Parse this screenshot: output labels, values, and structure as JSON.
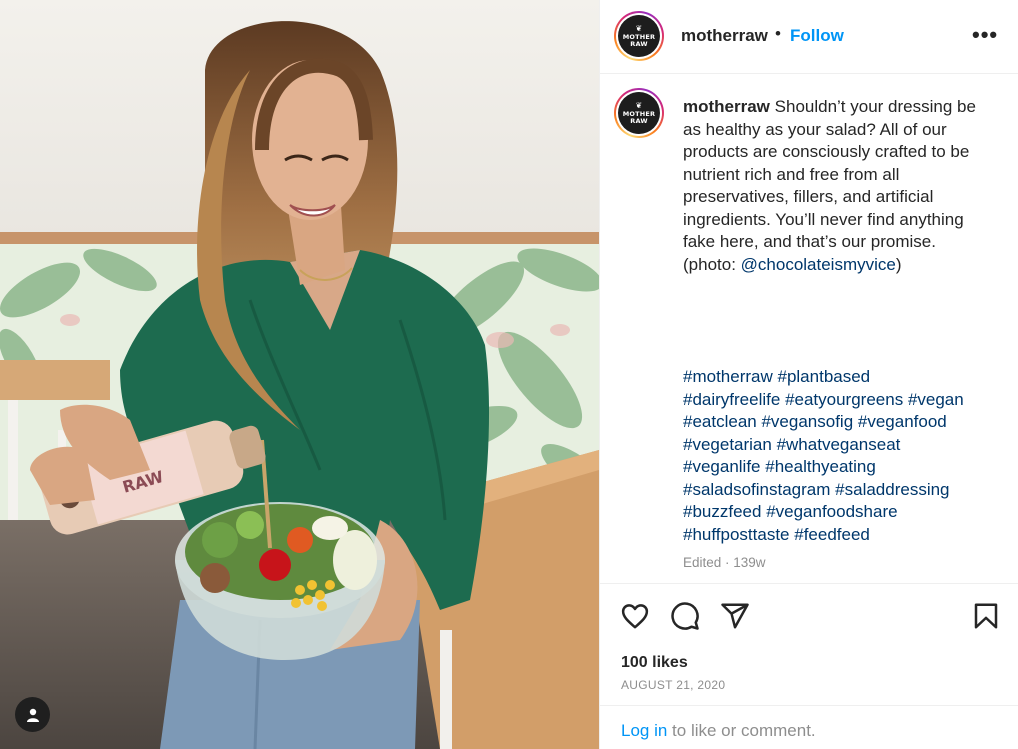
{
  "post": {
    "username": "motherraw",
    "header_separator": "•",
    "follow_label": "Follow",
    "more_label": "•••",
    "avatar_text": [
      "MOTHER",
      "RAW"
    ],
    "caption_user": "motherraw",
    "caption_text": " Shouldn’t your dressing be as healthy as your salad? All of our products are consciously crafted to be nutrient rich and free from all preservatives, fillers, and artificial ingredients. You’ll never find anything fake here, and that’s our promise. (photo: ",
    "caption_mention": "@chocolateismyvice",
    "caption_end": ")",
    "hashtags": [
      "#motherraw",
      "#plantbased",
      "#dairyfreelife",
      "#eatyourgreens",
      "#vegan",
      "#eatclean",
      "#vegansofig",
      "#veganfood",
      "#vegetarian",
      "#whatveganseat",
      "#veganlife",
      "#healthyeating",
      "#saladsofinstagram",
      "#saladdressing",
      "#buzzfeed",
      "#veganfoodshare",
      "#huffposttaste",
      "#feedfeed"
    ],
    "edited": "Edited · 139w",
    "likes": "100 likes",
    "date": "AUGUST 21, 2020",
    "login_link": "Log in",
    "login_rest": " to like or comment."
  },
  "icons": {
    "like": "heart-icon",
    "comment": "comment-icon",
    "share": "paper-plane-icon",
    "save": "bookmark-icon",
    "tagged_user": "user-icon"
  },
  "colors": {
    "link_blue": "#0095f6",
    "hashtag_blue": "#00376b",
    "muted": "#8e8e8e",
    "text": "#262626",
    "shirt_green": "#1d6b4f"
  }
}
